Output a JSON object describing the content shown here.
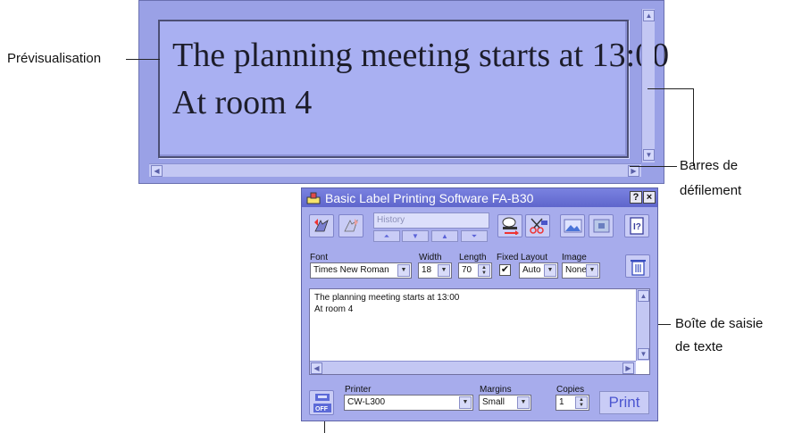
{
  "preview": {
    "line1": "The planning meeting starts at 13:00",
    "line2": "At room 4"
  },
  "callouts": {
    "preview": "Prévisualisation",
    "scrollbars_line1": "Barres de",
    "scrollbars_line2": "défilement",
    "textbox_line1": "Boîte de saisie",
    "textbox_line2": "de texte"
  },
  "app": {
    "title": "Basic Label Printing Software FA-B30",
    "title_help": "?",
    "title_close": "×",
    "history_placeholder": "History",
    "labels": {
      "font": "Font",
      "width": "Width",
      "length": "Length",
      "fixed": "Fixed",
      "layout": "Layout",
      "image": "Image",
      "printer": "Printer",
      "margins": "Margins",
      "copies": "Copies"
    },
    "values": {
      "font": "Times New Roman",
      "width": "18",
      "length": "70",
      "fixed_checked": true,
      "layout": "Auto",
      "image": "None",
      "printer": "CW-L300",
      "margins": "Small",
      "copies": "1"
    },
    "text_lines": [
      "The planning meeting starts at 13:00",
      "At room 4"
    ],
    "power_label": "OFF",
    "print_label": "Print"
  },
  "colors": {
    "preview_bg": "#a9b0f2",
    "window_bg": "#a7acec",
    "titlebar": "#5f66cc",
    "print_text": "#4c56d0"
  }
}
